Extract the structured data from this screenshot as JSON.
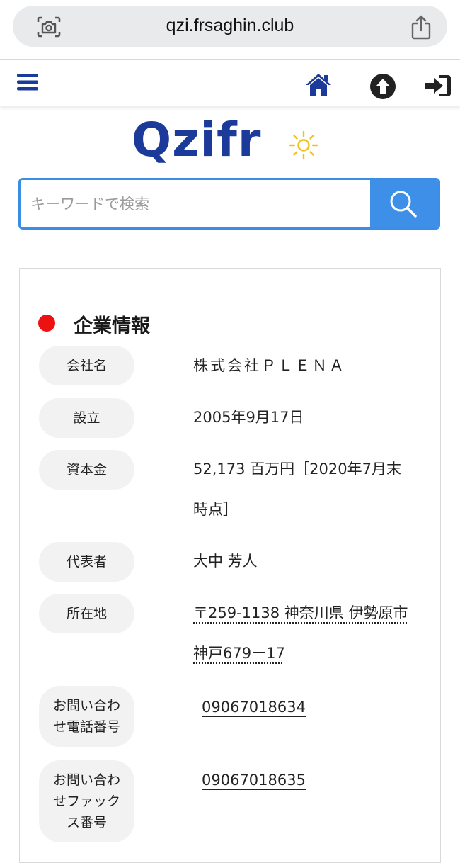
{
  "browser": {
    "url": "qzi.frsaghin.club"
  },
  "header": {
    "icons": [
      "menu-icon",
      "home-icon",
      "arrow-up-icon",
      "login-icon"
    ],
    "accent_color": "#1c3a99"
  },
  "logo": {
    "text": "Qzifr"
  },
  "search": {
    "placeholder": "キーワードで検索",
    "value": "",
    "button_color": "#3d8fe8"
  },
  "company": {
    "section_title": "企業情報",
    "rows": [
      {
        "label": "会社名",
        "value": "株式会社ＰＬＥＮＡ"
      },
      {
        "label": "設立",
        "value": "2005年9月17日"
      },
      {
        "label": "資本金",
        "value": "52,173 百万円［2020年7月末時点］"
      },
      {
        "label": "代表者",
        "value": "大中 芳人"
      },
      {
        "label": "所在地",
        "value": "〒259-1138 神奈川県 伊勢原市 神戸679ー17"
      },
      {
        "label": "お問い合わせ電話番号",
        "value": "09067018634"
      },
      {
        "label": "お問い合わせファックス番号",
        "value": "09067018635"
      }
    ]
  }
}
